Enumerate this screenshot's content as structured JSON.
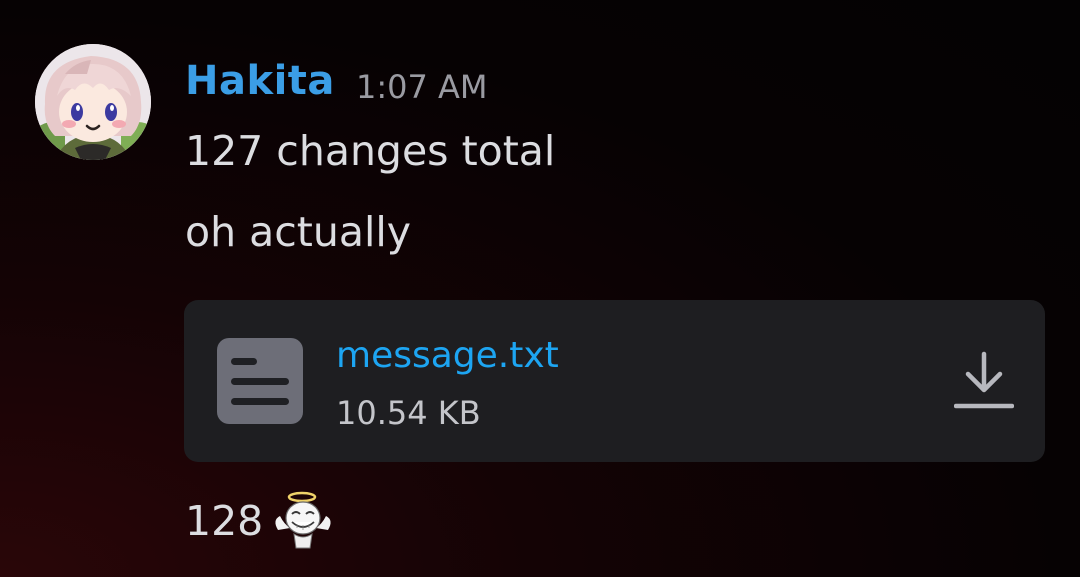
{
  "message": {
    "author": "Hakita",
    "timestamp": "1:07 AM",
    "author_color": "#3b9ee6",
    "lines": [
      "127 changes total",
      "oh actually"
    ],
    "attachment": {
      "file_name": "message.txt",
      "file_size": "10.54 KB",
      "file_icon": "text-file-icon",
      "action_icon": "download-icon",
      "link_color": "#1da5f2"
    },
    "followup": {
      "text": "128",
      "emoji": "angel-trollface-emoji"
    }
  }
}
